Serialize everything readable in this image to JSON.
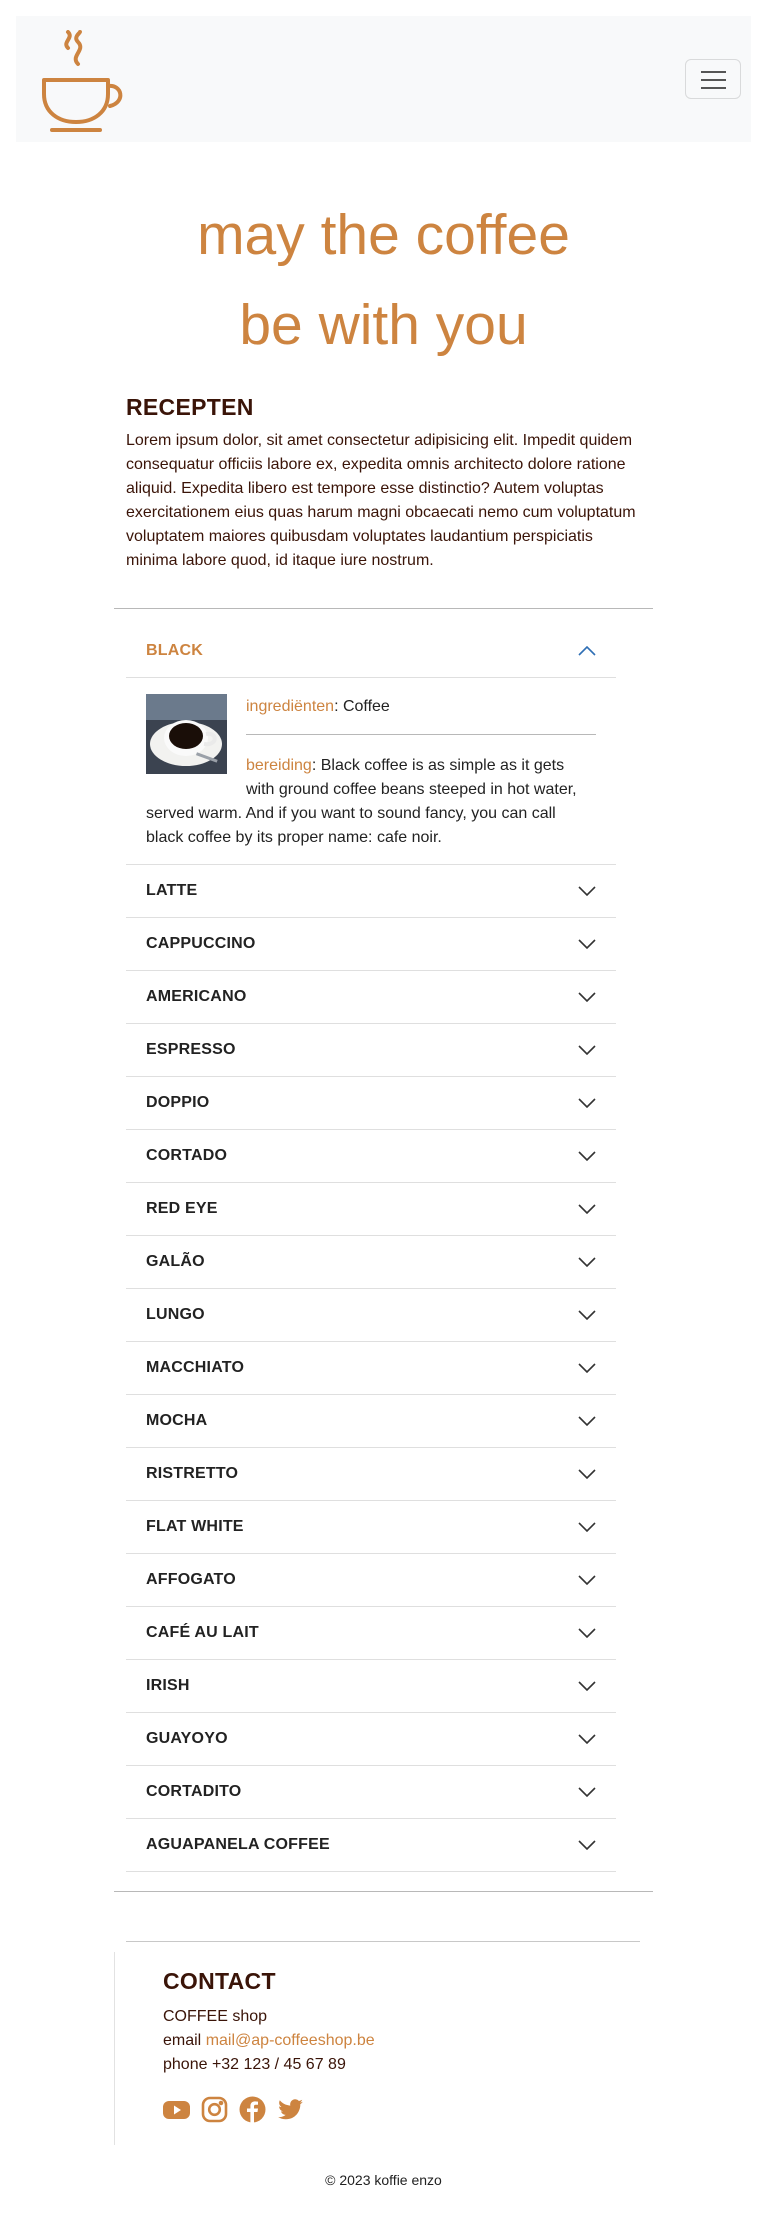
{
  "hero": {
    "line1": "may the coffee",
    "line2": "be with you"
  },
  "intro": {
    "title": "RECEPTEN",
    "text": "Lorem ipsum dolor, sit amet consectetur adipisicing elit. Impedit quidem consequatur officiis labore ex, expedita omnis architecto dolore ratione aliquid. Expedita libero est tempore esse distinctio? Autem voluptas exercitationem eius quas harum magni obcaecati nemo cum voluptatum voluptatem maiores quibusdam voluptates laudantium perspiciatis minima labore quod, id itaque iure nostrum."
  },
  "accordion": {
    "open_item": {
      "title": "BLACK",
      "ingredients_label": "ingrediënten",
      "ingredients": ": Coffee",
      "preparation_label": "bereiding",
      "preparation": ": Black coffee is as simple as it gets with ground coffee beans steeped in hot water, served warm. And if you want to sound fancy, you can call black coffee by its proper name: cafe noir."
    },
    "items": [
      "LATTE",
      "CAPPUCCINO",
      "AMERICANO",
      "ESPRESSO",
      "DOPPIO",
      "CORTADO",
      "RED EYE",
      "GALÃO",
      "LUNGO",
      "MACCHIATO",
      "MOCHA",
      "RISTRETTO",
      "FLAT WHITE",
      "AFFOGATO",
      "CAFÉ AU LAIT",
      "IRISH",
      "GUAYOYO",
      "CORTADITO",
      "AGUAPANELA COFFEE"
    ]
  },
  "contact": {
    "title": "CONTACT",
    "shop": "COFFEE shop",
    "email_label": "email ",
    "email": "mail@ap-coffeeshop.be",
    "phone": "phone +32 123 / 45 67 89"
  },
  "social_icons": [
    "youtube-icon",
    "instagram-icon",
    "facebook-icon",
    "twitter-icon"
  ],
  "footer": {
    "copyright": "© 2023 koffie enzo"
  },
  "colors": {
    "accent": "#cd8440",
    "text_dark": "#3a1408",
    "chevron_open": "#2f6fb5"
  }
}
